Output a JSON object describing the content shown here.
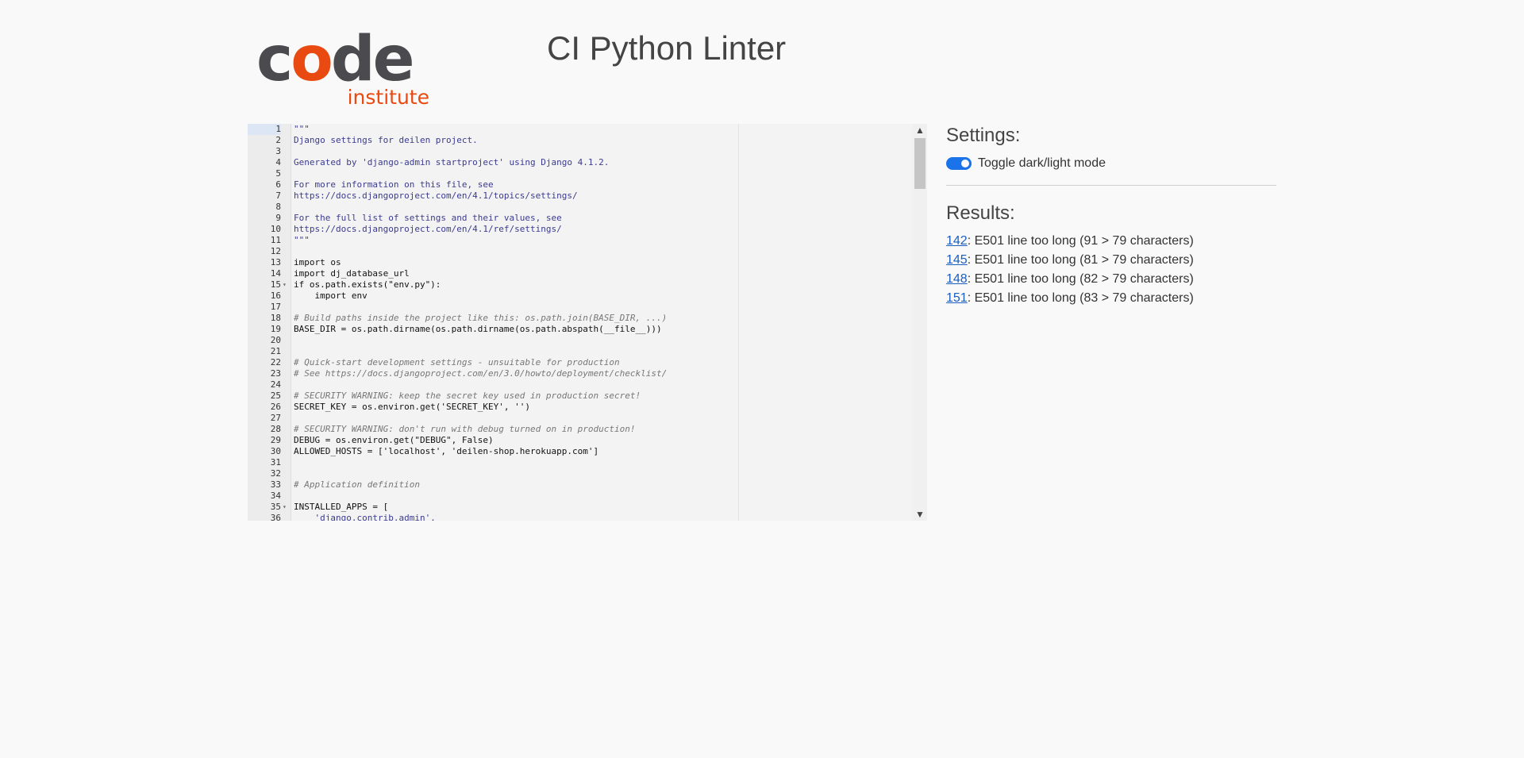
{
  "header": {
    "logo_main_prefix": "c",
    "logo_main_o": "o",
    "logo_main_suffix": "de",
    "logo_sub": "institute",
    "title": "CI Python Linter"
  },
  "colors": {
    "brand_orange": "#e84a11",
    "logo_dark": "#4a4a4f",
    "toggle_blue": "#1a73e8",
    "link_blue": "#1a5fbf"
  },
  "editor": {
    "active_line": 1,
    "lines": [
      {
        "n": "1",
        "text": "\"\"\"",
        "cls": "t-str",
        "fold": ""
      },
      {
        "n": "2",
        "text": "Django settings for deilen project.",
        "cls": "t-str",
        "fold": ""
      },
      {
        "n": "3",
        "text": "",
        "cls": "",
        "fold": ""
      },
      {
        "n": "4",
        "text": "Generated by 'django-admin startproject' using Django 4.1.2.",
        "cls": "t-str",
        "fold": ""
      },
      {
        "n": "5",
        "text": "",
        "cls": "",
        "fold": ""
      },
      {
        "n": "6",
        "text": "For more information on this file, see",
        "cls": "t-str",
        "fold": ""
      },
      {
        "n": "7",
        "text": "https://docs.djangoproject.com/en/4.1/topics/settings/",
        "cls": "t-str",
        "fold": ""
      },
      {
        "n": "8",
        "text": "",
        "cls": "",
        "fold": ""
      },
      {
        "n": "9",
        "text": "For the full list of settings and their values, see",
        "cls": "t-str",
        "fold": ""
      },
      {
        "n": "10",
        "text": "https://docs.djangoproject.com/en/4.1/ref/settings/",
        "cls": "t-str",
        "fold": ""
      },
      {
        "n": "11",
        "text": "\"\"\"",
        "cls": "t-str",
        "fold": ""
      },
      {
        "n": "12",
        "text": "",
        "cls": "",
        "fold": ""
      },
      {
        "n": "13",
        "text": "import os",
        "cls": "",
        "fold": ""
      },
      {
        "n": "14",
        "text": "import dj_database_url",
        "cls": "",
        "fold": ""
      },
      {
        "n": "15",
        "text": "if os.path.exists(\"env.py\"):",
        "cls": "",
        "fold": "▾"
      },
      {
        "n": "16",
        "text": "    import env",
        "cls": "",
        "fold": ""
      },
      {
        "n": "17",
        "text": "",
        "cls": "",
        "fold": ""
      },
      {
        "n": "18",
        "text": "# Build paths inside the project like this: os.path.join(BASE_DIR, ...)",
        "cls": "t-com",
        "fold": ""
      },
      {
        "n": "19",
        "text": "BASE_DIR = os.path.dirname(os.path.dirname(os.path.abspath(__file__)))",
        "cls": "",
        "fold": ""
      },
      {
        "n": "20",
        "text": "",
        "cls": "",
        "fold": ""
      },
      {
        "n": "21",
        "text": "",
        "cls": "",
        "fold": ""
      },
      {
        "n": "22",
        "text": "# Quick-start development settings - unsuitable for production",
        "cls": "t-com",
        "fold": ""
      },
      {
        "n": "23",
        "text": "# See https://docs.djangoproject.com/en/3.0/howto/deployment/checklist/",
        "cls": "t-com",
        "fold": ""
      },
      {
        "n": "24",
        "text": "",
        "cls": "",
        "fold": ""
      },
      {
        "n": "25",
        "text": "# SECURITY WARNING: keep the secret key used in production secret!",
        "cls": "t-com",
        "fold": ""
      },
      {
        "n": "26",
        "text": "SECRET_KEY = os.environ.get('SECRET_KEY', '')",
        "cls": "",
        "fold": ""
      },
      {
        "n": "27",
        "text": "",
        "cls": "",
        "fold": ""
      },
      {
        "n": "28",
        "text": "# SECURITY WARNING: don't run with debug turned on in production!",
        "cls": "t-com",
        "fold": ""
      },
      {
        "n": "29",
        "text": "DEBUG = os.environ.get(\"DEBUG\", False)",
        "cls": "",
        "fold": ""
      },
      {
        "n": "30",
        "text": "ALLOWED_HOSTS = ['localhost', 'deilen-shop.herokuapp.com']",
        "cls": "",
        "fold": ""
      },
      {
        "n": "31",
        "text": "",
        "cls": "",
        "fold": ""
      },
      {
        "n": "32",
        "text": "",
        "cls": "",
        "fold": ""
      },
      {
        "n": "33",
        "text": "# Application definition",
        "cls": "t-com",
        "fold": ""
      },
      {
        "n": "34",
        "text": "",
        "cls": "",
        "fold": ""
      },
      {
        "n": "35",
        "text": "INSTALLED_APPS = [",
        "cls": "",
        "fold": "▾"
      },
      {
        "n": "36",
        "text": "    'django.contrib.admin',",
        "cls": "t-str",
        "fold": ""
      }
    ],
    "scroll_up_icon": "▲",
    "scroll_down_icon": "▼"
  },
  "settings": {
    "heading": "Settings:",
    "toggle_label": "Toggle dark/light mode",
    "toggle_on": true
  },
  "results": {
    "heading": "Results:",
    "items": [
      {
        "line": "142",
        "message": ": E501 line too long (91 > 79 characters)"
      },
      {
        "line": "145",
        "message": ": E501 line too long (81 > 79 characters)"
      },
      {
        "line": "148",
        "message": ": E501 line too long (82 > 79 characters)"
      },
      {
        "line": "151",
        "message": ": E501 line too long (83 > 79 characters)"
      }
    ]
  }
}
